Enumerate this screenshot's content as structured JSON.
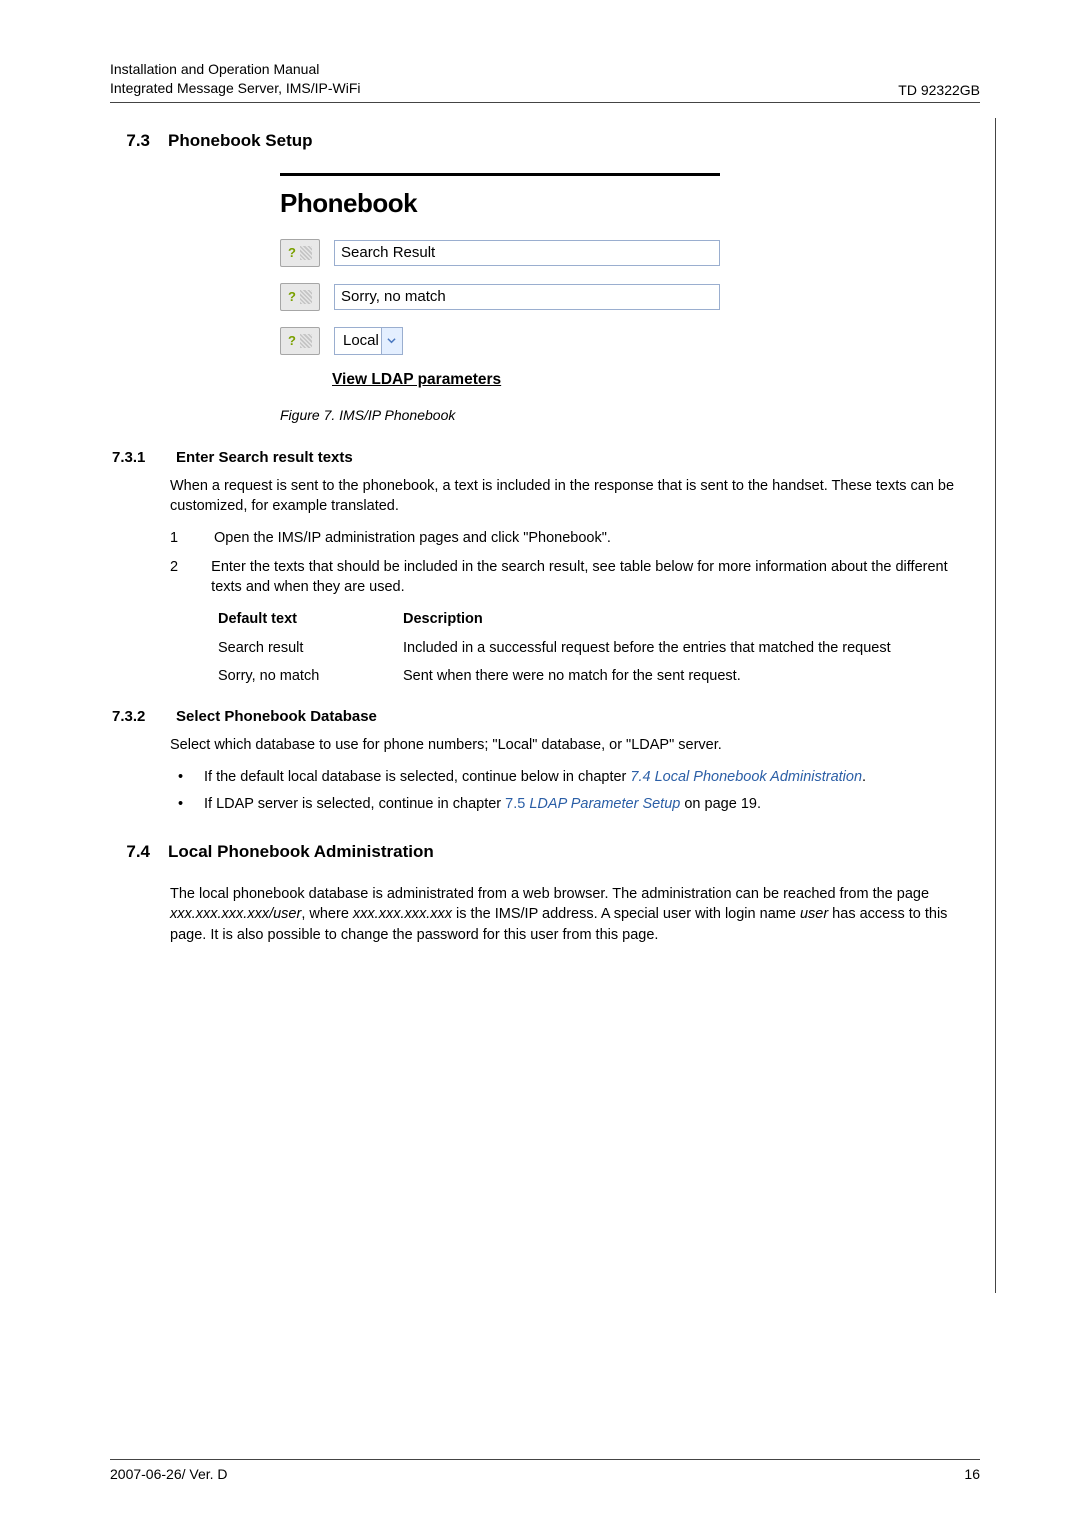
{
  "header": {
    "line1": "Installation and Operation Manual",
    "line2": "Integrated Message Server, IMS/IP-WiFi",
    "right": "TD 92322GB"
  },
  "sec73": {
    "num": "7.3",
    "title": "Phonebook Setup"
  },
  "figure": {
    "heading": "Phonebook",
    "input1": "Search Result",
    "input2": "Sorry, no match",
    "select": "Local",
    "link": "View LDAP parameters",
    "caption": "Figure 7. IMS/IP Phonebook"
  },
  "sec731": {
    "num": "7.3.1",
    "title": "Enter Search result texts",
    "intro": "When a request is sent to the phonebook, a text is included in the response that is sent to the handset. These texts can be customized, for example translated.",
    "ol1": "Open the IMS/IP administration pages and click \"Phonebook\".",
    "ol2": "Enter the texts that should be included in the search result, see table below for more information about the different texts and when they are used."
  },
  "table": {
    "h1": "Default text",
    "h2": "Description",
    "r1c1": "Search result",
    "r1c2": "Included in a successful request before the entries that matched the request",
    "r2c1": "Sorry, no match",
    "r2c2": "Sent when there were no match for the sent request."
  },
  "sec732": {
    "num": "7.3.2",
    "title": "Select Phonebook Database",
    "intro": "Select which database to use for phone numbers; \"Local\" database, or \"LDAP\" server.",
    "b1a": "If the default local database is selected, continue below in chapter ",
    "b1b": "7.4 Local Phonebook Administration",
    "b1c": ".",
    "b2a": "If LDAP server is selected, continue in chapter ",
    "b2b": "7.5 ",
    "b2c": "LDAP Parameter Setup",
    "b2d": " on page 19."
  },
  "sec74": {
    "num": "7.4",
    "title": "Local Phonebook Administration",
    "p": "The local phonebook database is administrated from a web browser. The administration can be reached from the page xxx.xxx.xxx.xxx/user, where xxx.xxx.xxx.xxx is the IMS/IP address. A special user with login name user has access to this page. It is also possible to change the password for this user from this page."
  },
  "footer": {
    "left": "2007-06-26/ Ver. D",
    "right": "16"
  }
}
